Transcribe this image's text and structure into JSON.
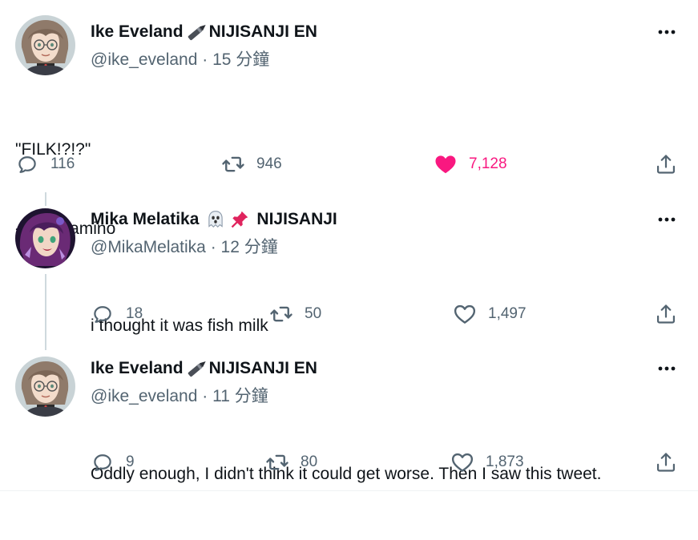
{
  "colors": {
    "text": "#0f1419",
    "secondary": "#536471",
    "like": "#f91880",
    "thread_line": "#cfd9de"
  },
  "tweets": [
    {
      "author": "Ike Eveland",
      "org": "NIJISANJI EN",
      "name_emoji": [
        "fountain-pen-icon"
      ],
      "handle": "@ike_eveland",
      "separator": "·",
      "time": "15 分鐘",
      "text_lines": [
        "\"FILK!?!?\"",
        "- Shu Yamino"
      ],
      "actions": {
        "reply": "116",
        "retweet": "946",
        "like": "7,128",
        "liked": true
      }
    },
    {
      "author": "Mika Melatika",
      "org": "NIJISANJI",
      "name_emoji": [
        "ghost-icon",
        "pushpin-icon"
      ],
      "handle": "@MikaMelatika",
      "separator": "·",
      "time": "12 分鐘",
      "text_lines": [
        "i thought it was fish milk"
      ],
      "actions": {
        "reply": "18",
        "retweet": "50",
        "like": "1,497",
        "liked": false
      }
    },
    {
      "author": "Ike Eveland",
      "org": "NIJISANJI EN",
      "name_emoji": [
        "fountain-pen-icon"
      ],
      "handle": "@ike_eveland",
      "separator": "·",
      "time": "11 分鐘",
      "text_lines": [
        "Oddly enough, I didn't think it could get worse. Then I saw this tweet."
      ],
      "actions": {
        "reply": "9",
        "retweet": "80",
        "like": "1,873",
        "liked": false
      }
    }
  ]
}
